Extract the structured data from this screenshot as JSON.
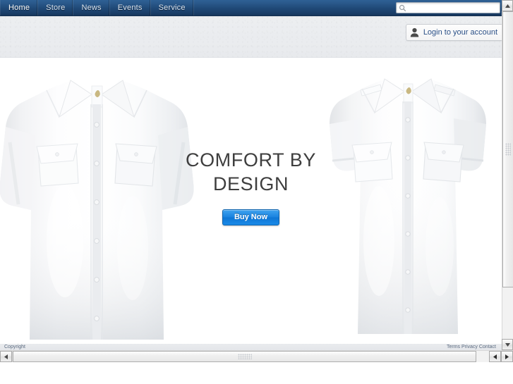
{
  "nav": {
    "items": [
      {
        "label": "Home"
      },
      {
        "label": "Store"
      },
      {
        "label": "News"
      },
      {
        "label": "Events"
      },
      {
        "label": "Service"
      }
    ]
  },
  "search": {
    "value": "",
    "placeholder": "",
    "icon": "search-icon"
  },
  "header": {
    "login": {
      "label": "Login to your account",
      "icon": "person-icon",
      "color": "#2a4f86"
    }
  },
  "hero": {
    "title": "COMFORT BY\nDESIGN",
    "cta": {
      "label": "Buy Now",
      "color": "#1a83e0"
    },
    "images": [
      {
        "name": "white-long-sleeve-dress-shirt",
        "alt": "White long sleeve dress shirt"
      },
      {
        "name": "white-short-sleeve-dress-shirt",
        "alt": "White short sleeve dress shirt"
      }
    ]
  },
  "footer": {
    "left": "Copyright",
    "right": "Terms  Privacy  Contact"
  },
  "scrollbars": {
    "vertical": {
      "up": "▲",
      "down": "▼"
    },
    "horizontal": {
      "left": "◀",
      "right": "▶"
    }
  },
  "colors": {
    "navbar_top": "#2e6094",
    "navbar_bottom": "#16365c",
    "accent": "#1a83e0",
    "header_band": "#eceef0",
    "hero_text": "#3e3e3e"
  }
}
